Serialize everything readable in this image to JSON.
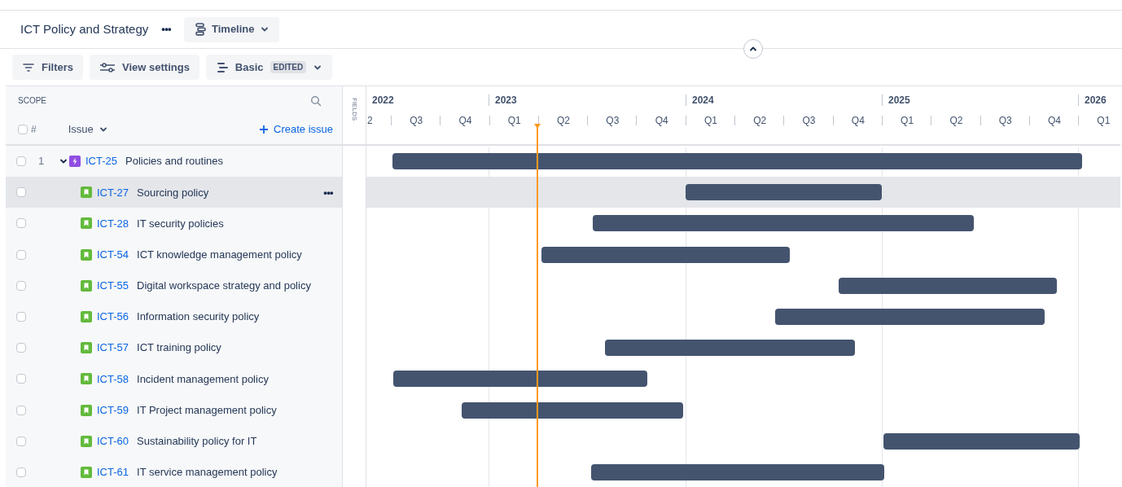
{
  "project": {
    "title": "ICT Policy and Strategy",
    "more": "•••",
    "view": "Timeline"
  },
  "toolbar": {
    "filters": "Filters",
    "view_settings": "View settings",
    "preset": "Basic",
    "preset_badge": "EDITED"
  },
  "scope": {
    "title": "SCOPE",
    "select_all_checked": false,
    "number_header": "#",
    "issue_header": "Issue",
    "create": "Create issue",
    "fields": "FIELDS"
  },
  "timeline": {
    "years": [
      "2022",
      "2023",
      "2024",
      "2025",
      "2026"
    ],
    "quarters": [
      "2",
      "Q3",
      "Q4",
      "Q1",
      "Q2",
      "Q3",
      "Q4",
      "Q1",
      "Q2",
      "Q3",
      "Q4",
      "Q1",
      "Q2",
      "Q3",
      "Q4",
      "Q1"
    ]
  },
  "issues": [
    {
      "number": "1",
      "key": "ICT-25",
      "summary": "Policies and routines",
      "kind": "epic",
      "expanded": true,
      "selected": false,
      "checked": false,
      "children": [
        {
          "key": "ICT-27",
          "summary": "Sourcing policy",
          "kind": "story",
          "selected": true,
          "checked": false,
          "more": "•••"
        },
        {
          "key": "ICT-28",
          "summary": "IT security policies",
          "kind": "story",
          "selected": false,
          "checked": false
        },
        {
          "key": "ICT-54",
          "summary": "ICT knowledge management policy",
          "kind": "story",
          "selected": false,
          "checked": false
        },
        {
          "key": "ICT-55",
          "summary": "Digital workspace strategy and policy",
          "kind": "story",
          "selected": false,
          "checked": false
        },
        {
          "key": "ICT-56",
          "summary": "Information security policy",
          "kind": "story",
          "selected": false,
          "checked": false
        },
        {
          "key": "ICT-57",
          "summary": "ICT training policy",
          "kind": "story",
          "selected": false,
          "checked": false
        },
        {
          "key": "ICT-58",
          "summary": "Incident management policy",
          "kind": "story",
          "selected": false,
          "checked": false
        },
        {
          "key": "ICT-59",
          "summary": "IT Project management policy",
          "kind": "story",
          "selected": false,
          "checked": false
        },
        {
          "key": "ICT-60",
          "summary": "Sustainability policy for IT",
          "kind": "story",
          "selected": false,
          "checked": false
        },
        {
          "key": "ICT-61",
          "summary": "IT service management policy",
          "kind": "story",
          "selected": false,
          "checked": false
        }
      ]
    }
  ]
}
